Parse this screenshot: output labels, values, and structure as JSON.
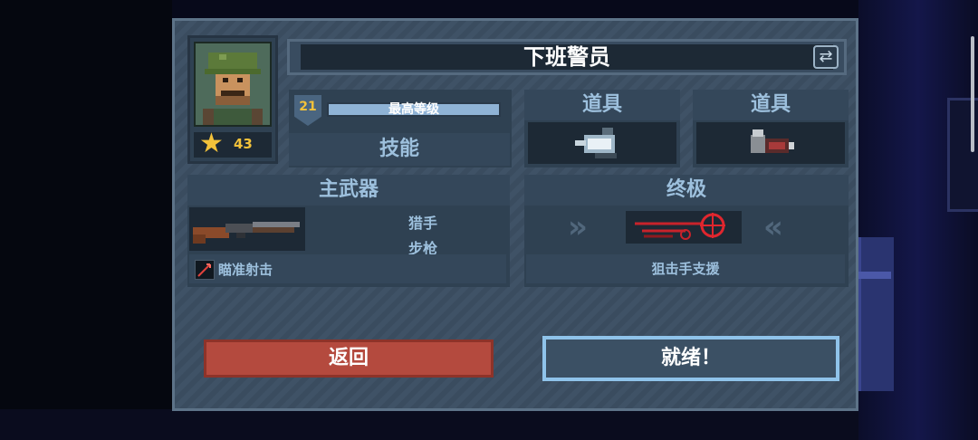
{
  "character": {
    "name": "下班警员",
    "stars": "43",
    "level": "21",
    "level_label": "最高等级",
    "skill_label": "技能"
  },
  "items": [
    {
      "label": "道具",
      "icon": "flash-grenade-icon"
    },
    {
      "label": "道具",
      "icon": "bullet-ammo-icon"
    }
  ],
  "primary_weapon": {
    "header": "主武器",
    "name_line1": "猎手",
    "name_line2": "步枪",
    "skill": "瞄准射击",
    "icon": "rifle-icon"
  },
  "ultimate": {
    "header": "终极",
    "skill": "狙击手支援",
    "icon": "sniper-scope-icon"
  },
  "buttons": {
    "back": "返回",
    "ready": "就绪！"
  },
  "colors": {
    "panel": "#3f5266",
    "accent_text": "#9dc0dd",
    "star": "#f3c23a",
    "back_button": "#b44a3e",
    "ready_border": "#8fc3ea"
  }
}
